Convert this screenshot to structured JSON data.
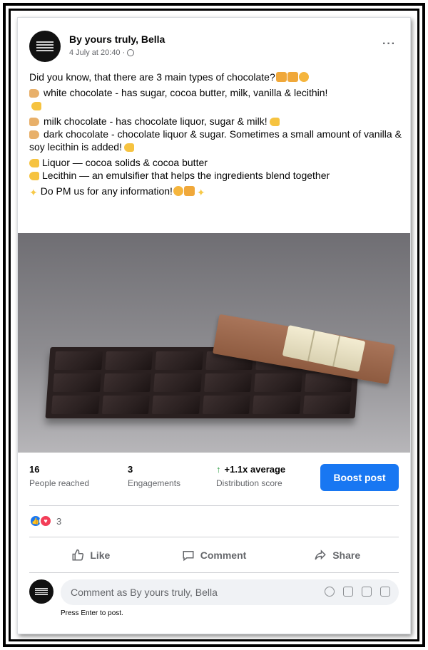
{
  "post": {
    "author": "By yours truly, Bella",
    "timestamp": "4 July at 20:40 ·",
    "more_label": "···",
    "lines": {
      "intro": "Did you know, that there are 3 main types of chocolate?",
      "white": "white chocolate - has sugar, cocoa butter, milk, vanilla & lecithin!",
      "milk": "milk chocolate - has chocolate liquor, sugar & milk!",
      "dark": "dark chocolate - chocolate liquor & sugar. Sometimes a small amount of vanilla & soy lecithin is added!",
      "liquor": "Liquor — cocoa solids & cocoa butter",
      "lecithin": "Lecithin — an emulsifier that helps the ingredients blend together",
      "pm": "Do PM us for any information!"
    }
  },
  "stats": {
    "reached_num": "16",
    "reached_label": "People reached",
    "engagements_num": "3",
    "engagements_label": "Engagements",
    "distribution_num": "+1.1x average",
    "distribution_label": "Distribution score",
    "boost_label": "Boost post"
  },
  "reactions": {
    "count": "3"
  },
  "actions": {
    "like": "Like",
    "comment": "Comment",
    "share": "Share"
  },
  "comment": {
    "placeholder": "Comment as By yours truly, Bella",
    "hint": "Press Enter to post."
  },
  "colors": {
    "accent": "#1877f2",
    "text": "#050505",
    "muted": "#65676b",
    "love": "#f33e58"
  }
}
